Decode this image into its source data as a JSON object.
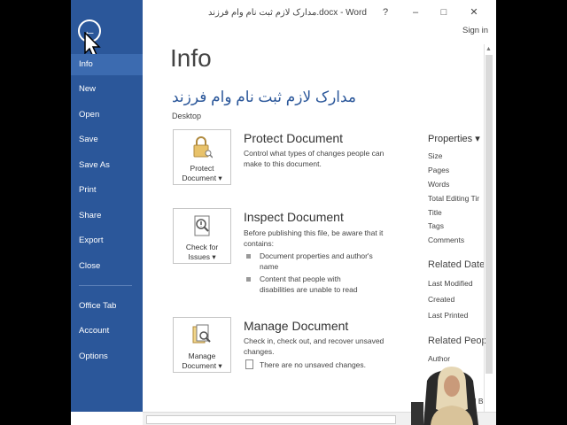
{
  "window": {
    "title": "مدارک لازم ثبت نام وام فرزند.docx - Word",
    "help": "?",
    "minimize": "–",
    "maximize": "□",
    "close": "✕",
    "sign_in": "Sign in"
  },
  "sidebar": {
    "back_glyph": "←",
    "items": [
      {
        "label": "Info"
      },
      {
        "label": "New"
      },
      {
        "label": "Open"
      },
      {
        "label": "Save"
      },
      {
        "label": "Save As"
      },
      {
        "label": "Print"
      },
      {
        "label": "Share"
      },
      {
        "label": "Export"
      },
      {
        "label": "Close"
      },
      {
        "label": "Office Tab"
      },
      {
        "label": "Account"
      },
      {
        "label": "Options"
      }
    ]
  },
  "main": {
    "page_title": "Info",
    "doc_name": "مدارک لازم ثبت نام وام فرزند",
    "doc_location": "Desktop",
    "protect": {
      "button_line1": "Protect",
      "button_line2": "Document ▾",
      "title": "Protect Document",
      "desc": "Control what types of changes people can make to this document."
    },
    "inspect": {
      "button_line1": "Check for",
      "button_line2": "Issues ▾",
      "title": "Inspect Document",
      "desc": "Before publishing this file, be aware that it contains:",
      "bullet1": "Document properties and author's name",
      "bullet2": "Content that people with disabilities are unable to read"
    },
    "manage": {
      "button_line1": "Manage",
      "button_line2": "Document ▾",
      "title": "Manage Document",
      "desc": "Check in, check out, and recover unsaved changes.",
      "note": "There are no unsaved changes."
    }
  },
  "properties": {
    "header": "Properties ▾",
    "items": [
      "Size",
      "Pages",
      "Words",
      "Total Editing Tir",
      "Title",
      "Tags",
      "Comments"
    ],
    "related_dates": "Related Date",
    "dates": [
      "Last Modified",
      "Created",
      "Last Printed"
    ],
    "related_people": "Related Peop",
    "people": [
      "Author"
    ],
    "partial": "ed B"
  },
  "colors": {
    "sidebar": "#2b579a",
    "accent": "#2b579a"
  }
}
